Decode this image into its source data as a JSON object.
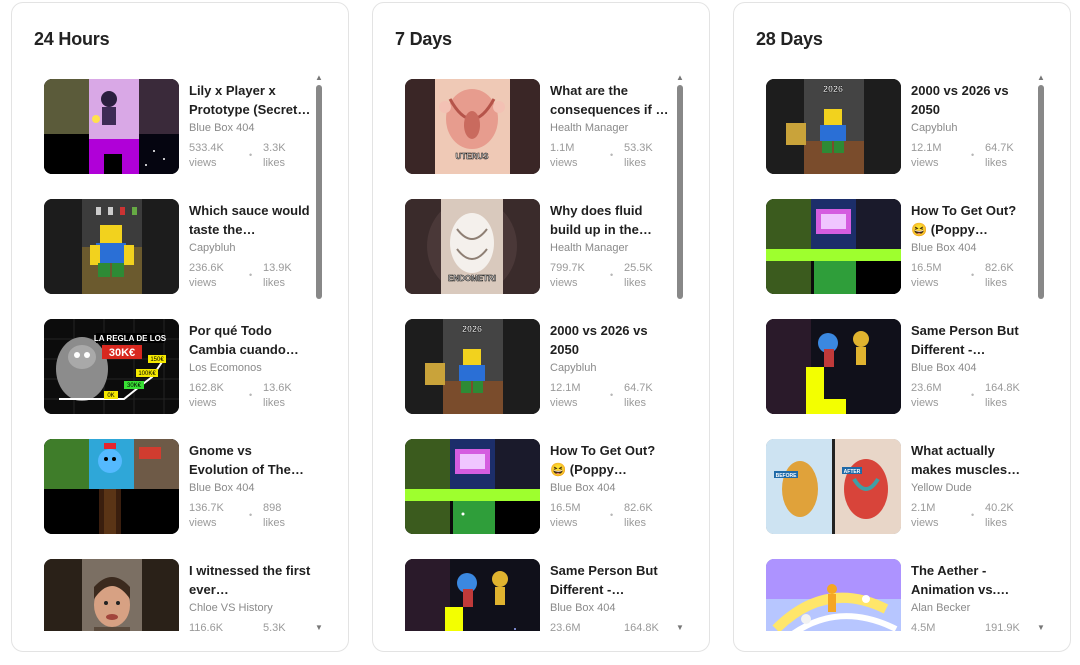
{
  "panels": [
    {
      "title": "24 Hours",
      "videos": [
        {
          "title": "Lily x Player x Prototype (Secret…",
          "channel": "Blue Box 404",
          "views": "533.4K",
          "views_label": "views",
          "likes": "3.3K",
          "likes_label": "likes"
        },
        {
          "title": "Which sauce would taste the…",
          "channel": "Capybluh",
          "views": "236.6K",
          "views_label": "views",
          "likes": "13.9K",
          "likes_label": "likes"
        },
        {
          "title": "Por qué Todo Cambia cuando…",
          "channel": "Los Ecomonos",
          "views": "162.8K",
          "views_label": "views",
          "likes": "13.6K",
          "likes_label": "likes"
        },
        {
          "title": "Gnome vs Evolution of The…",
          "channel": "Blue Box 404",
          "views": "136.7K",
          "views_label": "views",
          "likes": "898",
          "likes_label": "likes"
        },
        {
          "title": "I witnessed the first ever…",
          "channel": "Chloe VS History",
          "views": "116.6K",
          "views_label": "views",
          "likes": "5.3K",
          "likes_label": "likes"
        }
      ]
    },
    {
      "title": "7 Days",
      "videos": [
        {
          "title": "What are the consequences if …",
          "channel": "Health Manager",
          "views": "1.1M",
          "views_label": "views",
          "likes": "53.3K",
          "likes_label": "likes"
        },
        {
          "title": "Why does fluid build up in the…",
          "channel": "Health Manager",
          "views": "799.7K",
          "views_label": "views",
          "likes": "25.5K",
          "likes_label": "likes"
        },
        {
          "title": "2000 vs 2026 vs 2050",
          "channel": "Capybluh",
          "views": "12.1M",
          "views_label": "views",
          "likes": "64.7K",
          "likes_label": "likes"
        },
        {
          "title": "How To Get Out? 😆 (Poppy…",
          "channel": "Blue Box 404",
          "views": "16.5M",
          "views_label": "views",
          "likes": "82.6K",
          "likes_label": "likes"
        },
        {
          "title": "Same Person But Different -…",
          "channel": "Blue Box 404",
          "views": "23.6M",
          "views_label": "views",
          "likes": "164.8K",
          "likes_label": "likes"
        }
      ]
    },
    {
      "title": "28 Days",
      "videos": [
        {
          "title": "2000 vs 2026 vs 2050",
          "channel": "Capybluh",
          "views": "12.1M",
          "views_label": "views",
          "likes": "64.7K",
          "likes_label": "likes"
        },
        {
          "title": "How To Get Out? 😆 (Poppy…",
          "channel": "Blue Box 404",
          "views": "16.5M",
          "views_label": "views",
          "likes": "82.6K",
          "likes_label": "likes"
        },
        {
          "title": "Same Person But Different -…",
          "channel": "Blue Box 404",
          "views": "23.6M",
          "views_label": "views",
          "likes": "164.8K",
          "likes_label": "likes"
        },
        {
          "title": "What actually makes muscles…",
          "channel": "Yellow Dude",
          "views": "2.1M",
          "views_label": "views",
          "likes": "40.2K",
          "likes_label": "likes"
        },
        {
          "title": "The Aether - Animation vs.…",
          "channel": "Alan Becker",
          "views": "4.5M",
          "views_label": "views",
          "likes": "191.9K",
          "likes_label": "likes"
        }
      ]
    }
  ],
  "thumbnail_text": {
    "p0v2_banner": "LA REGLA DE LOS",
    "p0v2_price": "30K€",
    "p0v2_m1": "150€",
    "p0v2_m2": "100K€",
    "p0v2_m3": "30K€",
    "p0v2_m4": "0K",
    "p1v0_caption": "UTERUS",
    "p1v1_caption": "ENDOMETRI",
    "year_2026": "2026",
    "p2v3_before": "BEFORE",
    "p2v3_after": "AFTER"
  },
  "scroll_state": [
    {
      "position": 0.0,
      "visible_fraction": 0.4
    },
    {
      "position": 0.0,
      "visible_fraction": 0.4
    },
    {
      "position": 0.0,
      "visible_fraction": 0.4
    }
  ],
  "icons": {
    "scroll_up": "▲",
    "scroll_down": "▼",
    "separator": "•"
  }
}
